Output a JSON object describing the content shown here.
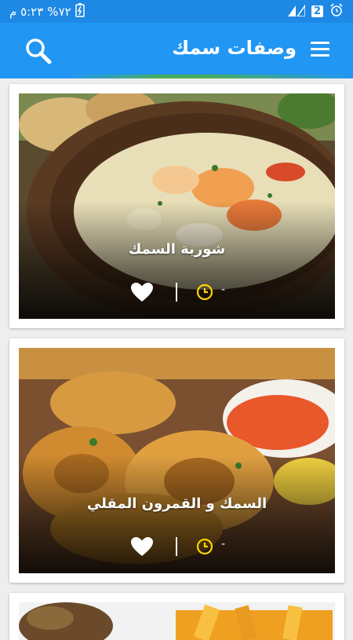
{
  "status_bar": {
    "time": "٥:٢٣ م",
    "battery": "%٧٢",
    "sim": "2"
  },
  "app_bar": {
    "title": "وصفات سمك",
    "search_icon": "search-icon",
    "menu_icon": "menu-icon"
  },
  "recipes": [
    {
      "title": "شوربة السمك",
      "time": "-"
    },
    {
      "title": "السمك و القمرون المقلي",
      "time": "-"
    },
    {
      "title": "",
      "time": ""
    }
  ],
  "colors": {
    "status_bar": "#1e88e5",
    "app_bar": "#2196f3",
    "clock": "#ffd600"
  }
}
